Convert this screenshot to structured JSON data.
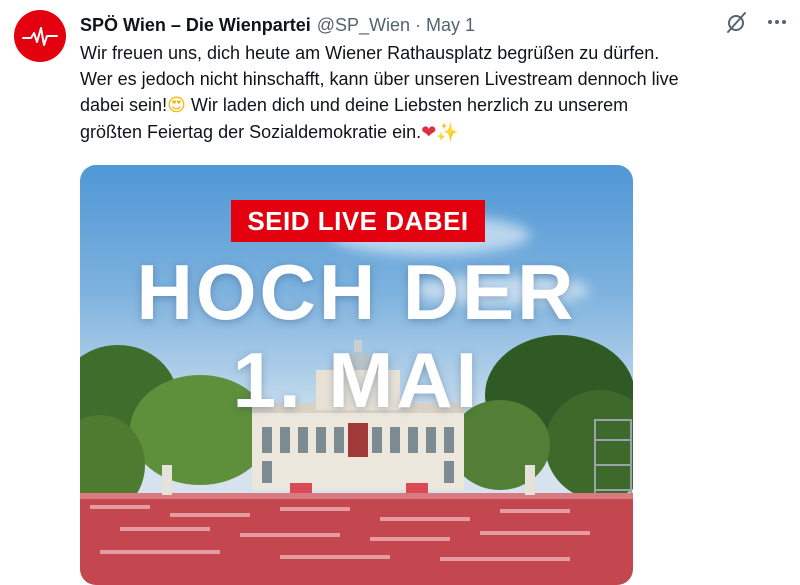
{
  "post": {
    "author": {
      "display_name": "SPÖ Wien – Die Wienpartei",
      "handle": "@SP_Wien",
      "separator": "·",
      "date": "May 1"
    },
    "text_lines": [
      "Wir freuen uns, dich heute am Wiener Rathausplatz begrüßen zu dürfen.",
      "Wer es jedoch nicht hinschafft, kann über unseren Livestream dennoch live",
      "dabei sein!",
      "Wir laden dich und deine Liebsten herzlich zu unserem",
      "größten Feiertag der Sozialdemokratie ein."
    ],
    "emojis": {
      "heart_eyes": "😍",
      "heart": "❤",
      "sparkles": "✨"
    },
    "media": {
      "banner_text": "SEID LIVE DABEI",
      "headline_1": "HOCH DER",
      "headline_2": "1. MAI"
    },
    "icons": {
      "avatar": "heartbeat-logo-icon",
      "grok": "grok-icon",
      "more": "more-icon"
    }
  },
  "colors": {
    "brand_red": "#e3000f",
    "text_primary": "#0f1419",
    "text_secondary": "#536471",
    "sky_top": "#4f97d6",
    "crowd_red": "#c4474f"
  }
}
